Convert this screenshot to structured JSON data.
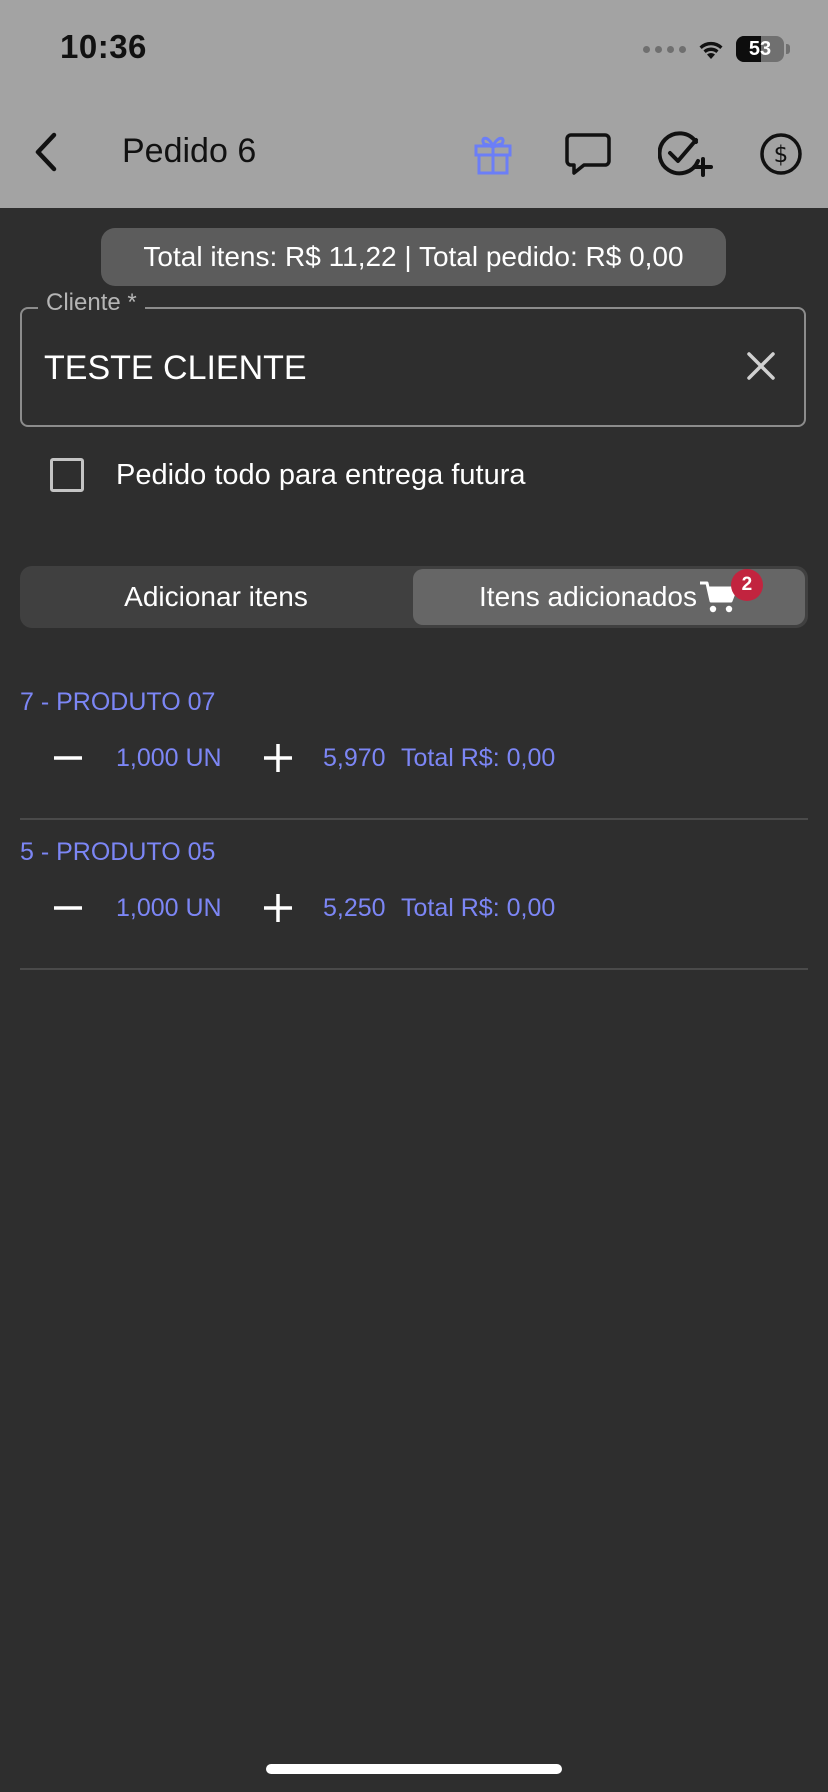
{
  "status_bar": {
    "time": "10:36",
    "battery_level": "53",
    "battery_percent": 53
  },
  "nav": {
    "title": "Pedido 6",
    "icons": [
      "back-chevron-icon",
      "gift-icon",
      "chat-bubble-icon",
      "check-add-icon",
      "dollar-circle-icon"
    ],
    "gift_icon_color": "#6b7ef7"
  },
  "totals": {
    "text": "Total itens: R$ 11,22 | Total pedido: R$ 0,00"
  },
  "client": {
    "label": "Cliente *",
    "value": "TESTE CLIENTE"
  },
  "future_delivery": {
    "label": "Pedido todo para entrega futura",
    "checked": false
  },
  "tabs": {
    "add_items": "Adicionar itens",
    "added_items": "Itens adicionados",
    "cart_count": "2",
    "active": "added_items"
  },
  "products": [
    {
      "name": "7 - PRODUTO 07",
      "quantity": "1,000 UN",
      "price": "5,970",
      "total": "Total R$: 0,00"
    },
    {
      "name": "5 - PRODUTO 05",
      "quantity": "1,000 UN",
      "price": "5,250",
      "total": "Total R$: 0,00"
    }
  ],
  "colors": {
    "header_bg": "#a3a3a3",
    "body_bg": "#2e2e2e",
    "accent": "#7c86f5",
    "badge": "#c2243f"
  }
}
